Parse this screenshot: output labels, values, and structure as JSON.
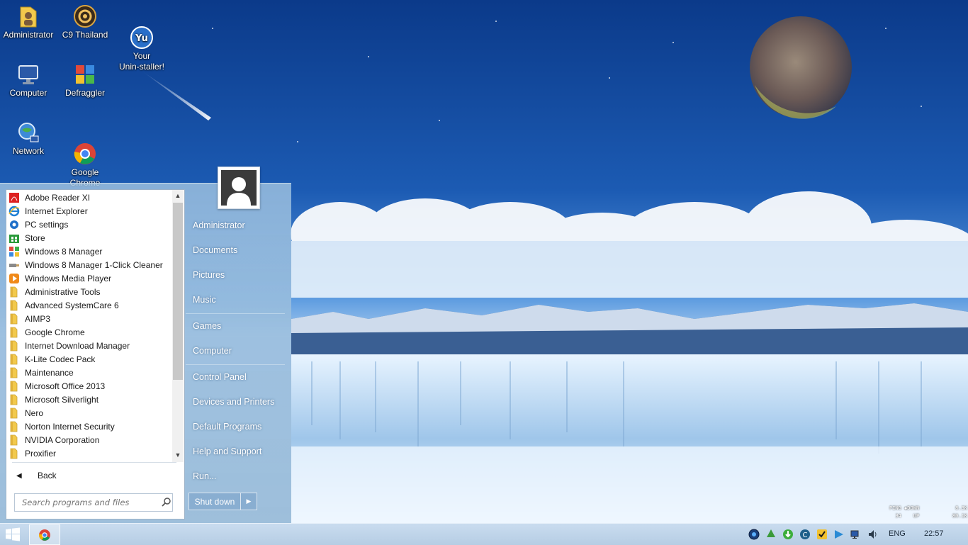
{
  "desktop": {
    "icons": [
      {
        "label": "Administrator"
      },
      {
        "label": "C9 Thailand"
      },
      {
        "label": "Your\nUnin-staller!"
      },
      {
        "label": "Computer"
      },
      {
        "label": "Defraggler"
      },
      {
        "label": "Network"
      },
      {
        "label": "Google\nChrome"
      }
    ]
  },
  "start_menu": {
    "programs": [
      {
        "label": "Adobe Reader XI",
        "icon": "pdf-icon"
      },
      {
        "label": "Internet Explorer",
        "icon": "ie-icon"
      },
      {
        "label": "PC settings",
        "icon": "gear-icon"
      },
      {
        "label": "Store",
        "icon": "store-icon"
      },
      {
        "label": "Windows 8 Manager",
        "icon": "win8-manager-icon"
      },
      {
        "label": "Windows 8 Manager 1-Click Cleaner",
        "icon": "brush-icon"
      },
      {
        "label": "Windows Media Player",
        "icon": "media-player-icon"
      },
      {
        "label": "Administrative Tools",
        "icon": "folder-icon"
      },
      {
        "label": "Advanced SystemCare 6",
        "icon": "folder-icon"
      },
      {
        "label": "AIMP3",
        "icon": "folder-icon"
      },
      {
        "label": "Google Chrome",
        "icon": "folder-icon"
      },
      {
        "label": "Internet Download Manager",
        "icon": "folder-icon"
      },
      {
        "label": "K-Lite Codec Pack",
        "icon": "folder-icon"
      },
      {
        "label": "Maintenance",
        "icon": "folder-icon"
      },
      {
        "label": "Microsoft Office 2013",
        "icon": "folder-icon"
      },
      {
        "label": "Microsoft Silverlight",
        "icon": "folder-icon"
      },
      {
        "label": "Nero",
        "icon": "folder-icon"
      },
      {
        "label": "Norton Internet Security",
        "icon": "folder-icon"
      },
      {
        "label": "NVIDIA Corporation",
        "icon": "folder-icon"
      },
      {
        "label": "Proxifier",
        "icon": "folder-icon"
      }
    ],
    "back_label": "Back",
    "search_placeholder": "Search programs and files",
    "right_items": {
      "user": "Administrator",
      "documents": "Documents",
      "pictures": "Pictures",
      "music": "Music",
      "games": "Games",
      "computer": "Computer",
      "control_panel": "Control Panel",
      "devices": "Devices and Printers",
      "default_programs": "Default Programs",
      "help": "Help and Support",
      "run": "Run..."
    },
    "shutdown_label": "Shut down"
  },
  "net_meter": {
    "ping_label": "PING",
    "down_label": "DOWN",
    "up_label": "UP",
    "ping": "34",
    "down_value": "8.3K",
    "up_value": "80.1K"
  },
  "taskbar": {
    "language": "ENG",
    "clock": "22:57"
  },
  "colors": {
    "sky_top": "#0e3f8f",
    "sky_horizon": "#7fb2e6",
    "start_menu": "#a6c4e0",
    "taskbar": "#c2d7ec"
  }
}
